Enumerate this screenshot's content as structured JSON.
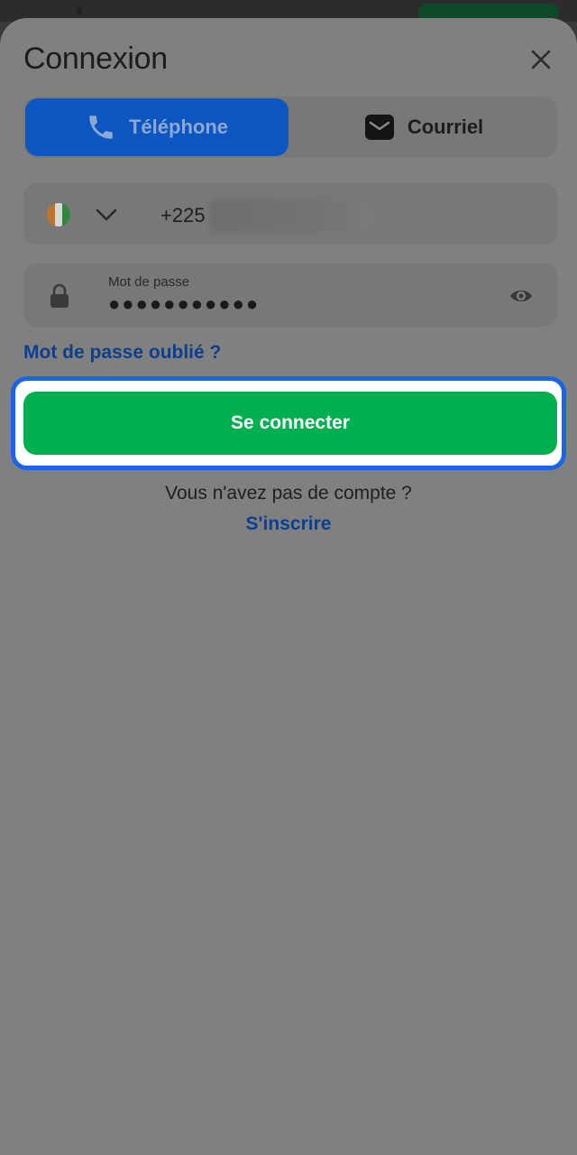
{
  "sheet": {
    "title": "Connexion"
  },
  "tabs": [
    {
      "label": "Téléphone",
      "icon": "phone-icon",
      "active": true
    },
    {
      "label": "Courriel",
      "icon": "mail-icon",
      "active": false
    }
  ],
  "phone": {
    "country_flag": "flag-cote-divoire-icon",
    "prefix": "+225"
  },
  "password": {
    "label": "Mot de passe",
    "value": "●●●●●●●●●●●"
  },
  "links": {
    "forgot": "Mot de passe oublié ?",
    "no_account": "Vous n'avez pas de compte ?",
    "signup": "S'inscrire"
  },
  "cta": {
    "label": "Se connecter"
  },
  "colors": {
    "primary_blue": "#0b56c1",
    "cta_green": "#00b050",
    "highlight_ring": "#1a64e8",
    "overlay": "#808080"
  }
}
